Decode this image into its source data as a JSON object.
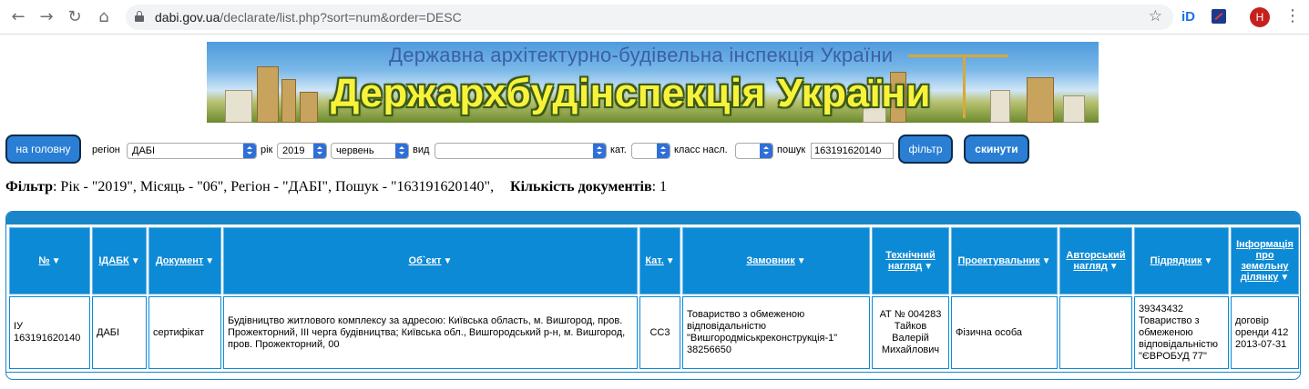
{
  "browser": {
    "url_domain": "dabi.gov.ua",
    "url_path": "/declarate/list.php?sort=num&order=DESC",
    "avatar_letter": "H",
    "ext1_label": "iD",
    "back_glyph": "←",
    "forward_glyph": "→",
    "reload_glyph": "↻",
    "home_glyph": "⌂",
    "star_glyph": "☆",
    "menu_glyph": "⋮"
  },
  "banner": {
    "subtitle": "Державна архітектурно-будівельна інспекція України",
    "title": "Держархбудінспекція України"
  },
  "toolbar": {
    "home_button": "на головну",
    "region_label": "регіон",
    "region_value": "ДАБІ",
    "year_label": "рік",
    "year_value": "2019",
    "month_value": "червень",
    "type_label": "вид",
    "type_value": "",
    "cat_label": "кат.",
    "cat_value": "",
    "class_label": "класс насл.",
    "class_value": "",
    "search_label": "пошук",
    "search_value": "163191620140",
    "filter_button": "фільтр",
    "reset_button": "скинути"
  },
  "summary": {
    "filter_label": "Фільтр",
    "filter_text": ": Рік - \"2019\", Місяць - \"06\", Регіон - \"ДАБІ\", Пошук - \"163191620140\",",
    "count_label": "Кількість документів",
    "count_value": ": 1"
  },
  "table": {
    "sort_glyph": "▼",
    "headers": [
      "№",
      "ІДАБК",
      "Документ",
      "Об`єкт",
      "Кат.",
      "Замовник",
      "Технічний нагляд",
      "Проектувальник",
      "Авторський нагляд",
      "Підрядник",
      "Інформація про земельну ділянку"
    ],
    "rows": [
      {
        "num": "ІУ 163191620140",
        "idabk": "ДАБІ",
        "document": "сертифікат",
        "object": "Будівництво житлового комплексу за адресою: Київська область, м. Вишгород, пров. Прожекторний, ІІІ черга будівництва; Київська обл., Вишгородський р-н, м. Вишгород, пров. Прожекторний, 00",
        "category": "СС3",
        "customer": "Товариство з обмеженою відповідальністю \"Вишгородміськреконструкція-1\" 38256650",
        "tech_supervision": "АТ № 004283 Тайков Валерій Михайлович",
        "designer": "Фізична особа",
        "author_supervision": "",
        "contractor": "39343432 Товариство з обмеженою відповідальністю \"ЄВРОБУД 77\"",
        "land_info": "договір оренди 412 2013-07-31"
      }
    ]
  }
}
